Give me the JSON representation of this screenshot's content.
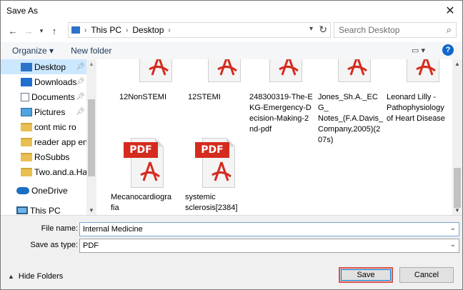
{
  "window": {
    "title": "Save As",
    "close_icon": "close-icon"
  },
  "nav": {
    "back_icon": "back-arrow-icon",
    "forward_icon": "forward-arrow-icon",
    "recent_icon": "chevron-down-icon",
    "up_icon": "up-arrow-icon",
    "breadcrumb": [
      "This PC",
      "Desktop"
    ],
    "search_placeholder": "Search Desktop"
  },
  "toolbar": {
    "organize_label": "Organize",
    "new_folder_label": "New folder",
    "help_label": "?"
  },
  "sidebar": {
    "items": [
      {
        "label": "Desktop",
        "icon": "desktop-folder-icon",
        "pinned": true,
        "selected": true
      },
      {
        "label": "Downloads",
        "icon": "downloads-icon",
        "pinned": true
      },
      {
        "label": "Documents",
        "icon": "documents-icon",
        "pinned": true
      },
      {
        "label": "Pictures",
        "icon": "pictures-icon",
        "pinned": true
      },
      {
        "label": "cont mic ro",
        "icon": "folder-icon"
      },
      {
        "label": "reader app en",
        "icon": "folder-icon"
      },
      {
        "label": "RoSubbs",
        "icon": "folder-icon"
      },
      {
        "label": "Two.and.a.Half.M",
        "icon": "folder-icon"
      },
      {
        "label": "OneDrive",
        "icon": "onedrive-icon"
      },
      {
        "label": "This PC",
        "icon": "this-pc-icon"
      }
    ]
  },
  "files": [
    {
      "name": "12NonSTEMI",
      "badge": ""
    },
    {
      "name": "12STEMI",
      "badge": ""
    },
    {
      "name": "248300319-The-EKG-Emergency-Decision-Making-2nd-pdf",
      "lines": [
        "248300319-The-E",
        "KG-Emergency-D",
        "ecision-Making-2",
        "nd-pdf"
      ]
    },
    {
      "name": "Jones_Sh.A._ECG_Notes_(F.A.Davis_Company,2005)(2007s)",
      "lines": [
        "Jones_Sh.A._ECG_",
        "Notes_(F.A.Davis_",
        "Company,2005)(2",
        "07s)"
      ]
    },
    {
      "name": "Leonard Lilly - Pathophysiology of Heart Disease",
      "lines": [
        "Leonard Lilly -",
        "Pathophysiology",
        "of Heart Disease"
      ]
    },
    {
      "name": "Mecanocardiografia",
      "badge": "PDF",
      "lines": [
        "Mecanocardiogra",
        "fia"
      ]
    },
    {
      "name": "systemic sclerosis[2384]",
      "badge": "PDF",
      "lines": [
        "systemic",
        "sclerosis[2384]"
      ]
    }
  ],
  "form": {
    "file_name_label": "File name:",
    "file_name_value": "Internal Medicine",
    "save_type_label": "Save as type:",
    "save_type_value": "PDF"
  },
  "footer": {
    "hide_folders_label": "Hide Folders",
    "save_label": "Save",
    "cancel_label": "Cancel"
  },
  "colors": {
    "selection": "#cce8ff",
    "pdf_red": "#d52b1e",
    "accent_blue": "#0078d7",
    "highlight_red": "#d9534f"
  }
}
